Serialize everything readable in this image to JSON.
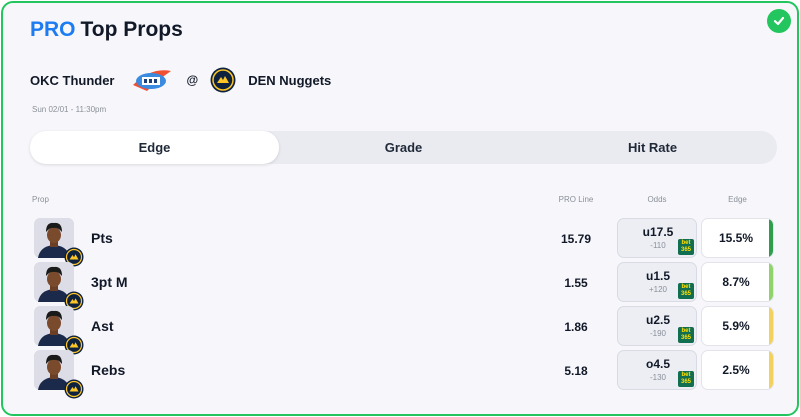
{
  "header": {
    "pro_label": "PRO",
    "title": "Top Props"
  },
  "matchup": {
    "home_team": "OKC Thunder",
    "at": "@",
    "away_team": "DEN Nuggets",
    "datetime": "Sun 02/01 - 11:30pm"
  },
  "tabs": [
    {
      "label": "Edge",
      "active": true
    },
    {
      "label": "Grade",
      "active": false
    },
    {
      "label": "Hit Rate",
      "active": false
    }
  ],
  "columns": {
    "prop": "Prop",
    "pro_line": "PRO Line",
    "odds": "Odds",
    "edge": "Edge"
  },
  "rows": [
    {
      "prop": "Pts",
      "pro_line": "15.79",
      "odds_line": "u17.5",
      "odds_price": "-110",
      "edge": "15.5%",
      "edge_color": "#2e9e4e"
    },
    {
      "prop": "3pt M",
      "pro_line": "1.55",
      "odds_line": "u1.5",
      "odds_price": "+120",
      "edge": "8.7%",
      "edge_color": "#8fd36a"
    },
    {
      "prop": "Ast",
      "pro_line": "1.86",
      "odds_line": "u2.5",
      "odds_price": "-190",
      "edge": "5.9%",
      "edge_color": "#f2d15c"
    },
    {
      "prop": "Rebs",
      "pro_line": "5.18",
      "odds_line": "o4.5",
      "odds_price": "-130",
      "edge": "2.5%",
      "edge_color": "#f2d15c"
    }
  ],
  "sportsbook": {
    "line1": "bet",
    "line2": "365"
  },
  "colors": {
    "accent": "#1d7cf2",
    "success": "#22c55e"
  },
  "icons": {
    "status": "check-circle-icon",
    "team_logo_home": "okc-thunder-logo",
    "team_logo_away": "den-nuggets-logo",
    "sportsbook": "bet365-logo"
  }
}
